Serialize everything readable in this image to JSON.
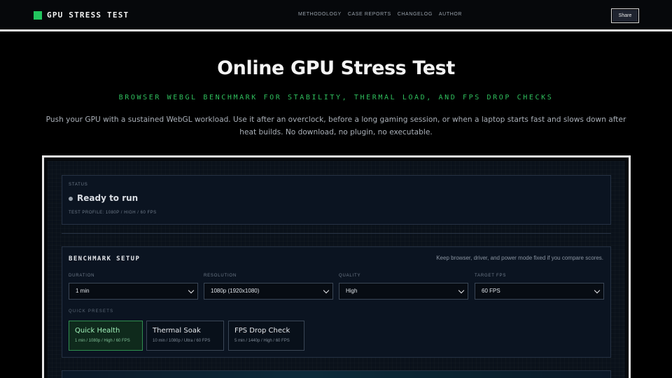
{
  "header": {
    "brand": "GPU STRESS TEST",
    "nav": [
      "METHODOLOGY",
      "CASE REPORTS",
      "CHANGELOG",
      "AUTHOR"
    ],
    "share_label": "Share",
    "accent_color": "#22c55e"
  },
  "hero": {
    "title": "Online GPU Stress Test",
    "subtitle": "BROWSER WEBGL BENCHMARK FOR STABILITY, THERMAL LOAD, AND FPS DROP CHECKS",
    "description": "Push your GPU with a sustained WebGL workload. Use it after an overclock, before a long gaming session, or when a laptop starts fast and slows down after heat builds. No download, no plugin, no executable."
  },
  "status": {
    "label": "STATUS",
    "text": "Ready to run",
    "profile": "TEST PROFILE: 1080P / HIGH / 60 FPS"
  },
  "setup": {
    "title": "BENCHMARK SETUP",
    "hint": "Keep browser, driver, and power mode fixed if you compare scores.",
    "fields": [
      {
        "label": "DURATION",
        "value": "1 min"
      },
      {
        "label": "RESOLUTION",
        "value": "1080p (1920x1080)"
      },
      {
        "label": "QUALITY",
        "value": "High"
      },
      {
        "label": "TARGET FPS",
        "value": "60 FPS"
      }
    ],
    "presets_label": "QUICK PRESETS",
    "presets": [
      {
        "name": "Quick Health",
        "meta": "1 min / 1080p / High / 60 FPS",
        "active": true
      },
      {
        "name": "Thermal Soak",
        "meta": "10 min / 1080p / Ultra / 60 FPS",
        "active": false
      },
      {
        "name": "FPS Drop Check",
        "meta": "5 min / 1440p / High / 60 FPS",
        "active": false
      }
    ]
  }
}
